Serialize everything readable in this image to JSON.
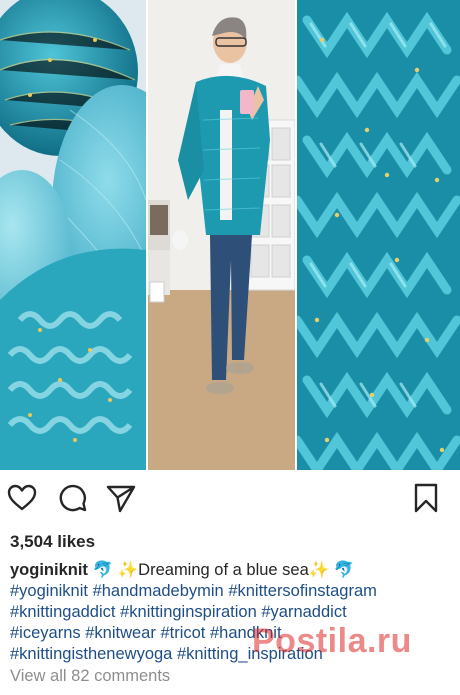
{
  "post": {
    "likes": "3,504 likes",
    "username": "yoginiknit",
    "caption_text": " 🐬 ✨Dreaming of a blue sea✨ 🐬",
    "hashtags": [
      "#yoginiknit",
      "#handmadebymin",
      "#knittersofinstagram",
      "#knittingaddict",
      "#knittinginspiration",
      "#yarnaddict",
      "#iceyarns",
      "#knitwear",
      "#tricot",
      "#handknit",
      "#knittingisthenewyoga",
      "#knitting_inspiration"
    ],
    "view_all_comments": "View all 82 comments"
  },
  "actions": {
    "like_icon": "heart-outline-icon",
    "comment_icon": "speech-bubble-icon",
    "share_icon": "paper-plane-icon",
    "save_icon": "bookmark-outline-icon"
  },
  "watermark": "Postila.ru",
  "colors": {
    "text": "#262626",
    "hashtag": "#1f4e86",
    "muted": "#8e8e8e",
    "turquoise": "#1b8ea6",
    "watermark": "#dc2828"
  }
}
